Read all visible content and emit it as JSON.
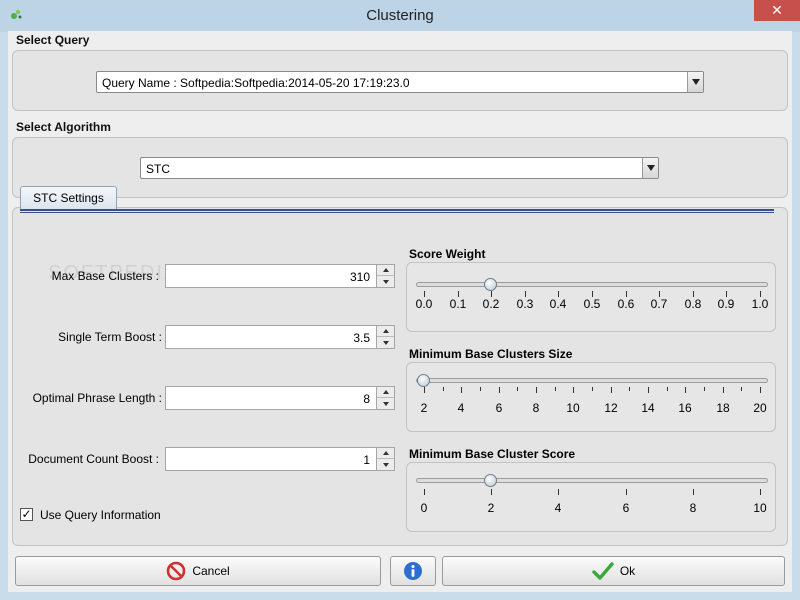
{
  "window": {
    "title": "Clustering",
    "close_glyph": "✕"
  },
  "select_query": {
    "label": "Select Query",
    "value": "Query Name : Softpedia:Softpedia:2014-05-20 17:19:23.0"
  },
  "select_algorithm": {
    "label": "Select Algorithm",
    "value": "STC"
  },
  "tab": {
    "label": "STC Settings"
  },
  "fields": {
    "max_base_clusters": {
      "label": "Max Base Clusters :",
      "value": "310"
    },
    "single_term_boost": {
      "label": "Single Term Boost :",
      "value": "3.5"
    },
    "optimal_phrase_length": {
      "label": "Optimal Phrase Length :",
      "value": "8"
    },
    "document_count_boost": {
      "label": "Document Count Boost :",
      "value": "1"
    }
  },
  "use_query_information": {
    "label": "Use Query Information",
    "checked": true
  },
  "sliders": {
    "score_weight": {
      "title": "Score Weight",
      "min": 0.0,
      "max": 1.0,
      "value": 0.2,
      "labels": [
        "0.0",
        "0.1",
        "0.2",
        "0.3",
        "0.4",
        "0.5",
        "0.6",
        "0.7",
        "0.8",
        "0.9",
        "1.0"
      ]
    },
    "min_base_clusters_size": {
      "title": "Minimum Base Clusters Size",
      "min": 2,
      "max": 20,
      "value": 2,
      "labels": [
        "2",
        "4",
        "6",
        "8",
        "10",
        "12",
        "14",
        "16",
        "18",
        "20"
      ]
    },
    "min_base_cluster_score": {
      "title": "Minimum Base Cluster Score",
      "min": 0,
      "max": 10,
      "value": 2,
      "labels": [
        "0",
        "2",
        "4",
        "6",
        "8",
        "10"
      ]
    }
  },
  "buttons": {
    "cancel": "Cancel",
    "ok": "Ok"
  },
  "watermark": "SOFTPEDIA",
  "colors": {
    "titlebar": "#bdd3e6",
    "close": "#c7504c",
    "cancel_icon": "#d0312d",
    "ok_icon": "#3aa83a",
    "info_icon": "#2d6fd1"
  }
}
